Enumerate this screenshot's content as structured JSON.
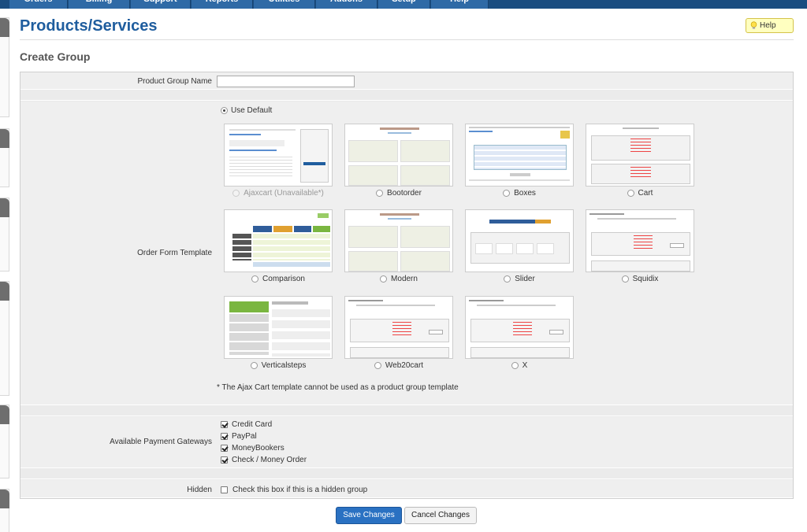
{
  "topnav": {
    "tabs": [
      "Orders",
      "Billing",
      "Support",
      "Reports",
      "Utilities",
      "Addons",
      "Setup",
      "Help"
    ]
  },
  "header": {
    "title": "Products/Services",
    "help_label": "Help",
    "help_icon": "lightbulb-icon"
  },
  "section": {
    "title": "Create Group"
  },
  "form": {
    "product_group_name": {
      "label": "Product Group Name",
      "value": ""
    },
    "order_form_template": {
      "label": "Order Form Template",
      "use_default_label": "Use Default",
      "use_default_selected": true,
      "templates": [
        {
          "name": "Ajaxcart (Unavailable*)",
          "disabled": true
        },
        {
          "name": "Bootorder",
          "disabled": false
        },
        {
          "name": "Boxes",
          "disabled": false
        },
        {
          "name": "Cart",
          "disabled": false
        },
        {
          "name": "Comparison",
          "disabled": false
        },
        {
          "name": "Modern",
          "disabled": false
        },
        {
          "name": "Slider",
          "disabled": false
        },
        {
          "name": "Squidix",
          "disabled": false
        },
        {
          "name": "Verticalsteps",
          "disabled": false
        },
        {
          "name": "Web20cart",
          "disabled": false
        },
        {
          "name": "X",
          "disabled": false
        }
      ],
      "note": "* The Ajax Cart template cannot be used as a product group template"
    },
    "payment_gateways": {
      "label": "Available Payment Gateways",
      "items": [
        {
          "name": "Credit Card",
          "checked": true
        },
        {
          "name": "PayPal",
          "checked": true
        },
        {
          "name": "MoneyBookers",
          "checked": true
        },
        {
          "name": "Check / Money Order",
          "checked": true
        }
      ]
    },
    "hidden": {
      "label": "Hidden",
      "checkbox_label": "Check this box if this is a hidden group",
      "checked": false
    }
  },
  "buttons": {
    "save": "Save Changes",
    "cancel": "Cancel Changes"
  },
  "colors": {
    "nav": "#1a4d80",
    "title": "#1f5d9e",
    "save_button": "#2a71c2",
    "help_bg": "#ffffc0"
  }
}
